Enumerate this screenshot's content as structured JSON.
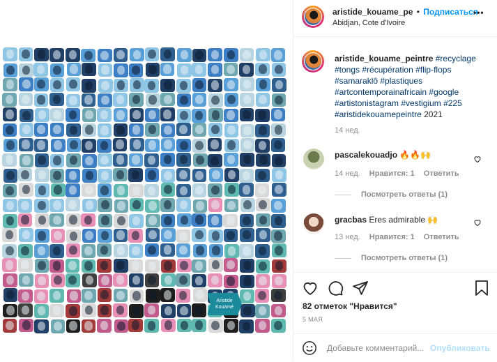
{
  "post": {
    "signature_lines": [
      "Aristide",
      "Kouamé"
    ],
    "palette": [
      "#3c7fc4",
      "#5aa0d8",
      "#2f5f8f",
      "#8fc6e6",
      "#1f3f66",
      "#e88fb6",
      "#c25a8b",
      "#3e3e3e",
      "#1d1d1d",
      "#6fa7b0",
      "#b8d4e0",
      "#a33a3a",
      "#5fb9b0",
      "#d9d9d9"
    ]
  },
  "header": {
    "username": "aristide_kouame_pe",
    "dot": "•",
    "follow": "Подписаться",
    "location": "Abidjan, Cote d'Ivoire",
    "more": "•••"
  },
  "caption": {
    "username": "aristide_kouame_peintre",
    "text": "#recyclage #tongs #récupération #flip-flops #samaraklô #plastiques #artcontemporainafricain #google #artistonistagram #vestigium #225 #aristidekouamepeintre",
    "year": "2021",
    "time": "14 нед."
  },
  "comments": [
    {
      "username": "pascalekouadjo",
      "text": "🔥🔥🙌",
      "time": "14 нед.",
      "likes": "Нравится: 1",
      "reply": "Ответить",
      "view_replies": "Посмотреть ответы (1)"
    },
    {
      "username": "gracbas",
      "text": "Eres admirable 🙌",
      "time": "13 нед.",
      "likes": "Нравится: 1",
      "reply": "Ответить",
      "view_replies": "Посмотреть ответы (1)"
    }
  ],
  "actions": {
    "likes_count": "82 отметок \"Нравится\"",
    "date": "5 МАЯ"
  },
  "add_comment": {
    "placeholder": "Добавьте комментарий...",
    "publish": "Опубликовать"
  }
}
